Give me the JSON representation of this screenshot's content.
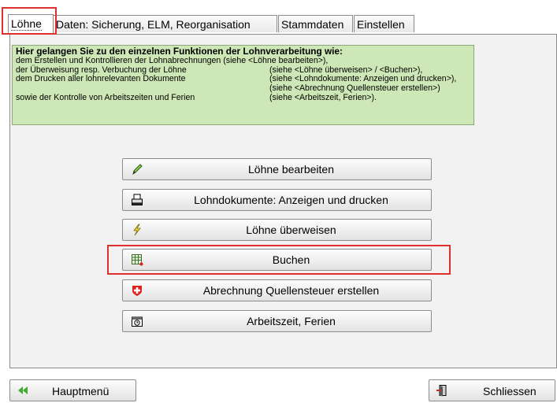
{
  "tabs": [
    {
      "label": "Löhne"
    },
    {
      "label": "Daten: Sicherung, ELM, Reorganisation"
    },
    {
      "label": "Stammdaten"
    },
    {
      "label": "Einstellen"
    }
  ],
  "info": {
    "title": "Hier gelangen Sie zu den einzelnen Funktionen der Lohnverarbeitung wie:",
    "rows": [
      {
        "left": "dem Erstellen und Kontrollieren der Lohnabrechnungen (siehe <Löhne bearbeiten>),",
        "right": ""
      },
      {
        "left": "der Überweisung resp. Verbuchung der Löhne",
        "right": "(siehe <Löhne überweisen> / <Buchen>),"
      },
      {
        "left": "dem Drucken aller lohnrelevanten Dokumente",
        "right": "(siehe <Lohndokumente: Anzeigen und drucken>),"
      },
      {
        "left": "",
        "right": "(siehe <Abrechnung Quellensteuer erstellen>)"
      },
      {
        "left": "sowie der Kontrolle von Arbeitszeiten und Ferien",
        "right": "(siehe <Arbeitszeit, Ferien>)."
      }
    ]
  },
  "buttons": [
    {
      "label": "Löhne bearbeiten",
      "icon": "pencil-icon"
    },
    {
      "label": "Lohndokumente: Anzeigen und drucken",
      "icon": "printer-icon"
    },
    {
      "label": "Löhne überweisen",
      "icon": "lightning-icon"
    },
    {
      "label": "Buchen",
      "icon": "ledger-icon"
    },
    {
      "label": "Abrechnung Quellensteuer erstellen",
      "icon": "swiss-cross-icon"
    },
    {
      "label": "Arbeitszeit, Ferien",
      "icon": "clock-calendar-icon"
    }
  ],
  "footer": {
    "main_menu": "Hauptmenü",
    "close": "Schliessen"
  },
  "colors": {
    "info_background": "#cde8b6",
    "highlight": "#e0302c"
  }
}
